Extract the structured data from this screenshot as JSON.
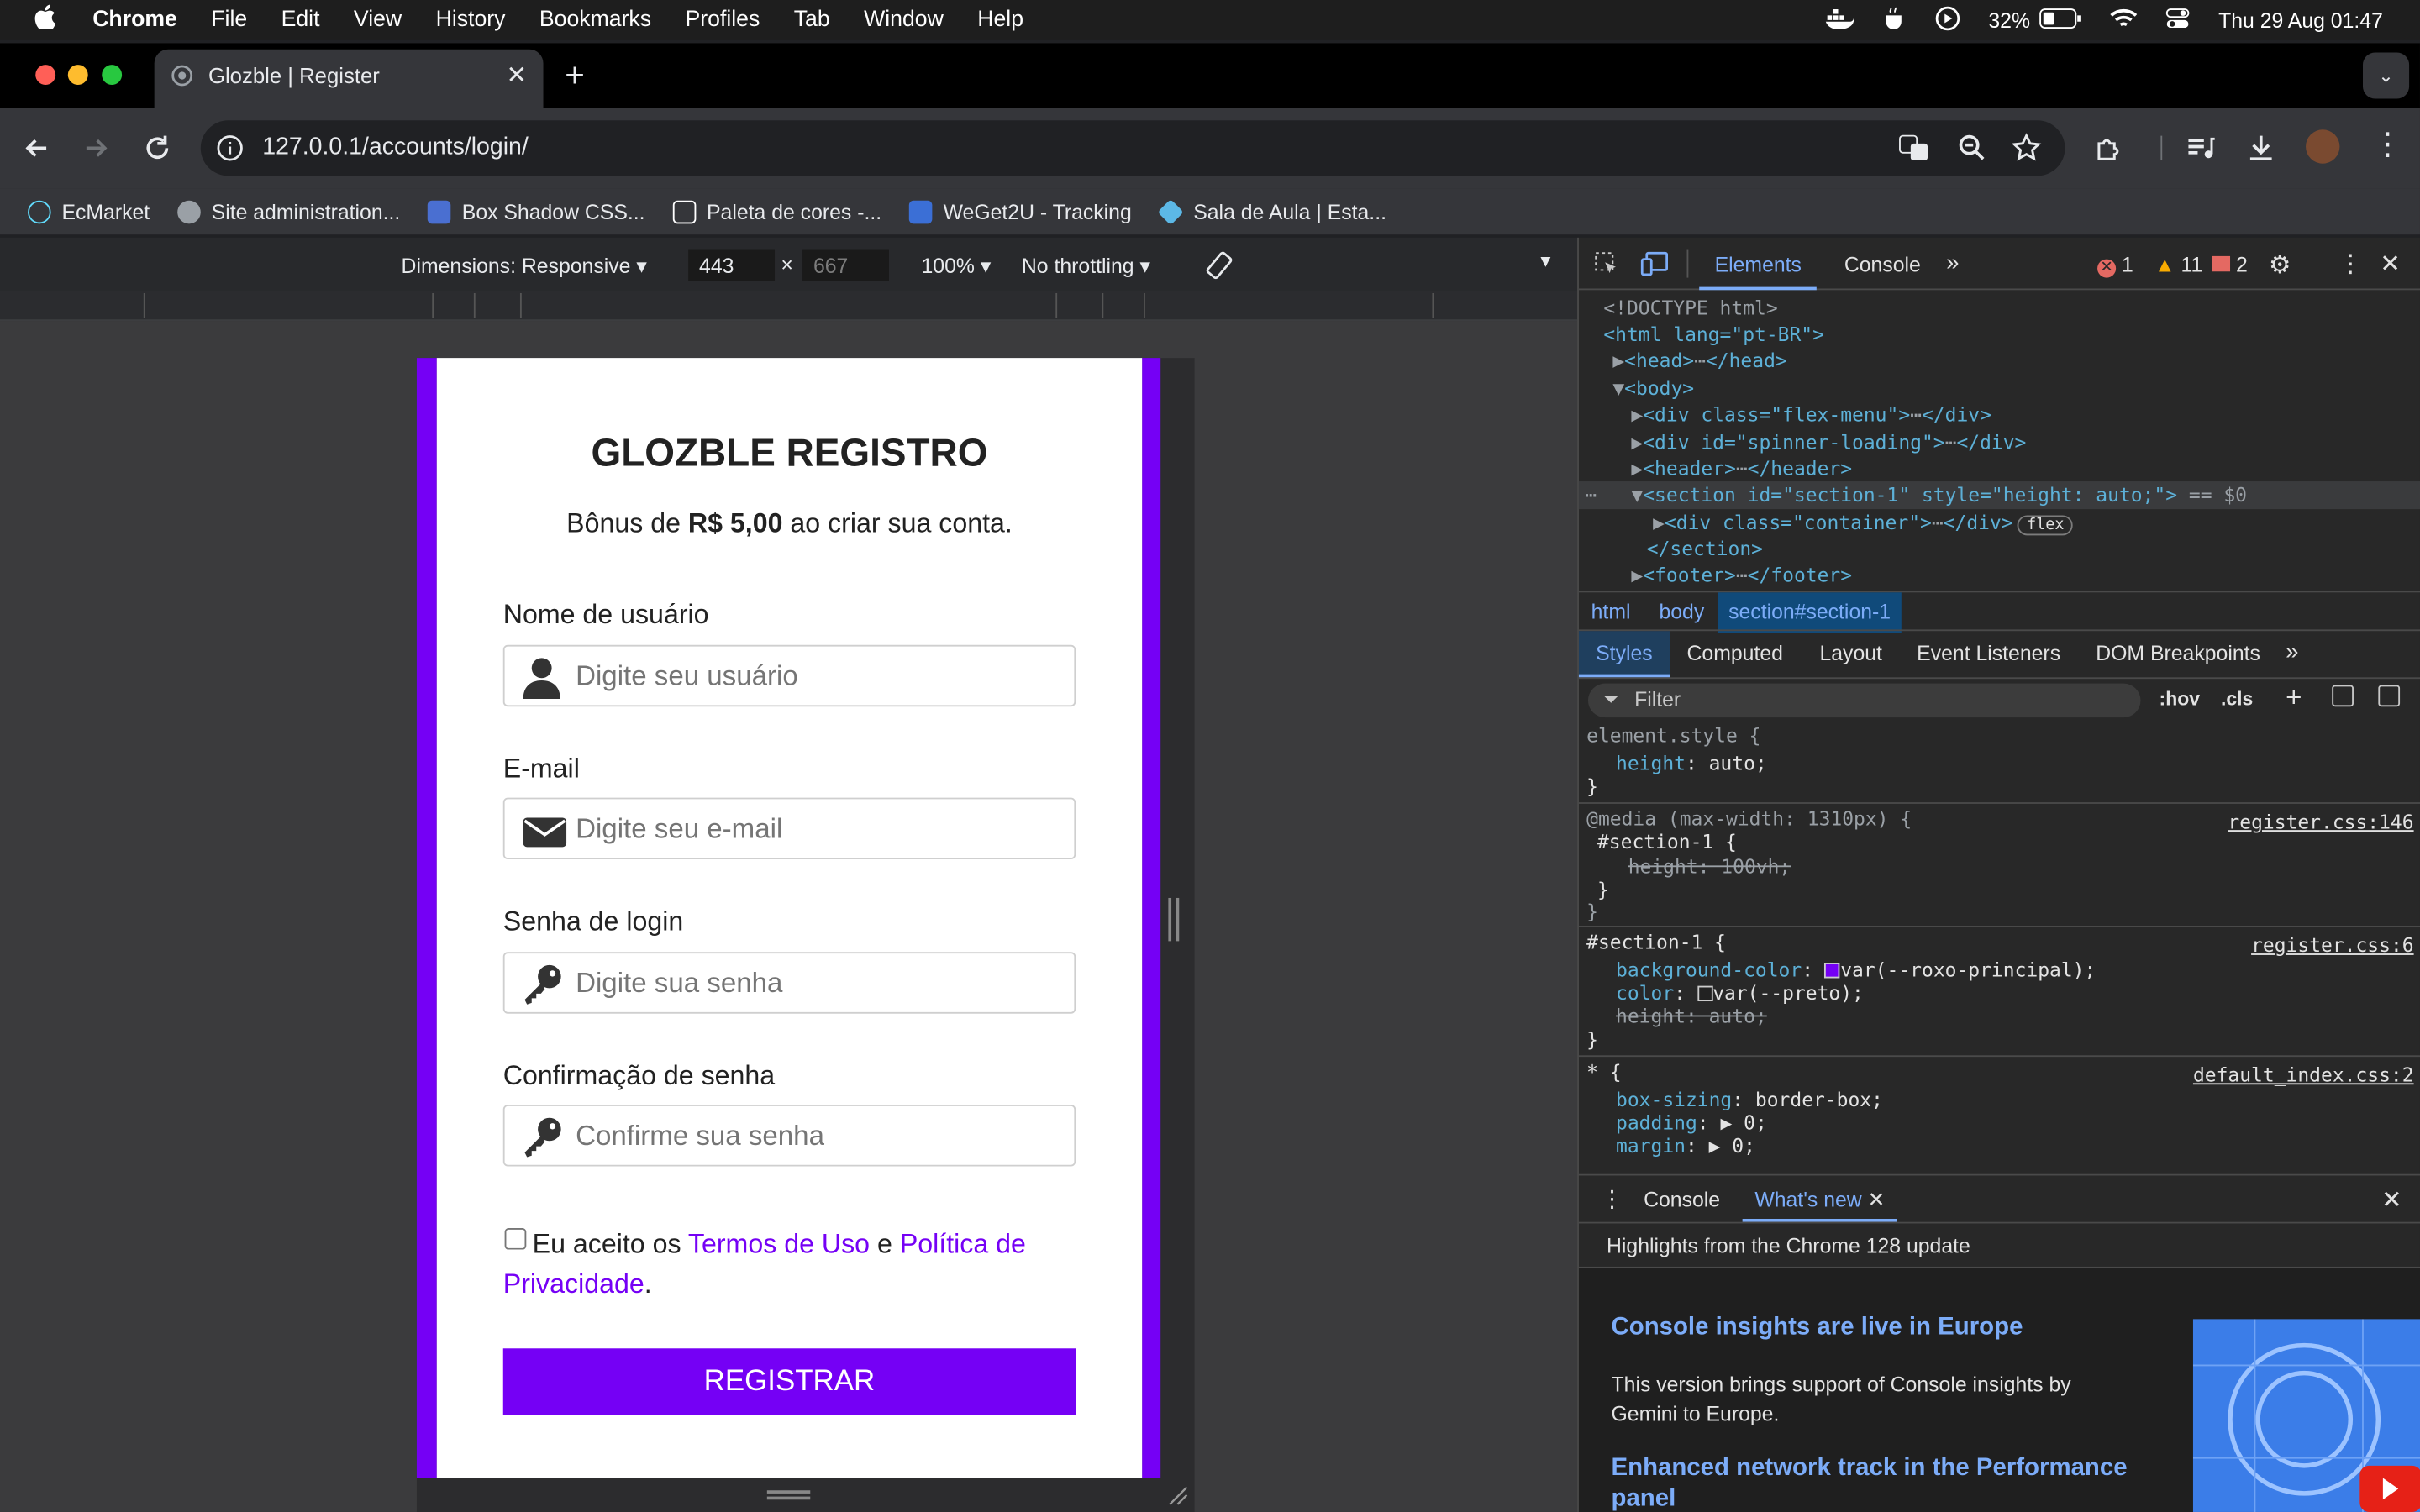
{
  "menubar": {
    "apple": "",
    "app": "Chrome",
    "items": [
      "File",
      "Edit",
      "View",
      "History",
      "Bookmarks",
      "Profiles",
      "Tab",
      "Window",
      "Help"
    ],
    "battery": "32%",
    "datetime": "Thu 29 Aug  01:47"
  },
  "browser": {
    "tab_title": "Glozble | Register",
    "new_tab": "+",
    "url": "127.0.0.1/accounts/login/",
    "bookmarks": [
      {
        "label": "EcMarket",
        "color": "#61dafb"
      },
      {
        "label": "Site administration...",
        "color": "#9aa0a6"
      },
      {
        "label": "Box Shadow CSS...",
        "color": "#4a6fd1"
      },
      {
        "label": "Paleta de cores -...",
        "color": "#ffffff"
      },
      {
        "label": "WeGet2U - Tracking",
        "color": "#3b6fd6"
      },
      {
        "label": "Sala de Aula | Esta...",
        "color": "#5cb8e6"
      }
    ]
  },
  "device_toolbar": {
    "dimensions": "Dimensions: Responsive",
    "width": "443",
    "times": "×",
    "height": "667",
    "zoom": "100%",
    "throttling": "No throttling"
  },
  "form": {
    "title": "GLOZBLE REGISTRO",
    "bonus_prefix": "Bônus de ",
    "bonus_amount": "R$ 5,00",
    "bonus_suffix": " ao criar sua conta.",
    "username_label": "Nome de usuário",
    "username_placeholder": "Digite seu usuário",
    "email_label": "E-mail",
    "email_placeholder": "Digite seu e-mail",
    "password_label": "Senha de login",
    "password_placeholder": "Digite sua senha",
    "confirm_label": "Confirmação de senha",
    "confirm_placeholder": "Confirme sua senha",
    "terms_prefix": "Eu aceito os ",
    "terms_link": "Termos de Uso",
    "terms_and": " e ",
    "privacy_link": "Política de Privacidade",
    "terms_end": ".",
    "submit": "REGISTRAR",
    "accent_color": "#7500f5"
  },
  "devtools": {
    "tabs": [
      "Elements",
      "Console"
    ],
    "errors": "1",
    "warnings": "11",
    "issues": "2",
    "dom": {
      "doctype": "<!DOCTYPE html>",
      "html_open": "<html lang=\"pt-BR\">",
      "head": "<head>",
      "head_close": "</head>",
      "body": "<body>",
      "div_menu": "<div class=\"flex-menu\">",
      "div_close": "</div>",
      "div_spinner": "<div id=\"spinner-loading\">",
      "header": "<header>",
      "header_close": "</header>",
      "section": "<section id=\"section-1\" style=\"height: auto;\">",
      "section_marker": " == $0",
      "container": "<div class=\"container\">",
      "flex_badge": "flex",
      "section_close": "</section>",
      "footer": "<footer>",
      "footer_close": "</footer>"
    },
    "breadcrumbs": [
      "html",
      "body",
      "section#section-1"
    ],
    "style_tabs": [
      "Styles",
      "Computed",
      "Layout",
      "Event Listeners",
      "DOM Breakpoints"
    ],
    "filter_placeholder": "Filter",
    "hov": ":hov",
    "cls": ".cls",
    "rules": {
      "r1_selector": "element.style {",
      "r1_prop": "height",
      "r1_val": ": auto;",
      "close": "}",
      "r2_media": "@media (max-width: 1310px) {",
      "r2_source": "register.css:146",
      "r2_selector": "#section-1 {",
      "r2_prop": "height: 100vh;",
      "r3_selector": "#section-1 {",
      "r3_source": "register.css:6",
      "r3_p1": "background-color",
      "r3_v1": "var(--roxo-principal);",
      "r3_p2": "color",
      "r3_v2": "var(--preto);",
      "r3_p3": "height: auto;",
      "r4_selector": "* {",
      "r4_source": "default_index.css:2",
      "r4_p1": "box-sizing",
      "r4_v1": ": border-box;",
      "r4_p2": "padding",
      "r4_v2": "0;",
      "r4_p3": "margin",
      "r4_v3": "0;"
    },
    "drawer_tabs": [
      "Console",
      "What's new"
    ],
    "highlights": "Highlights from the Chrome 128 update",
    "news1_title": "Console insights are live in Europe",
    "news1_body": "This version brings support of Console insights by Gemini to Europe.",
    "news2_title": "Enhanced network track in the Performance panel"
  }
}
